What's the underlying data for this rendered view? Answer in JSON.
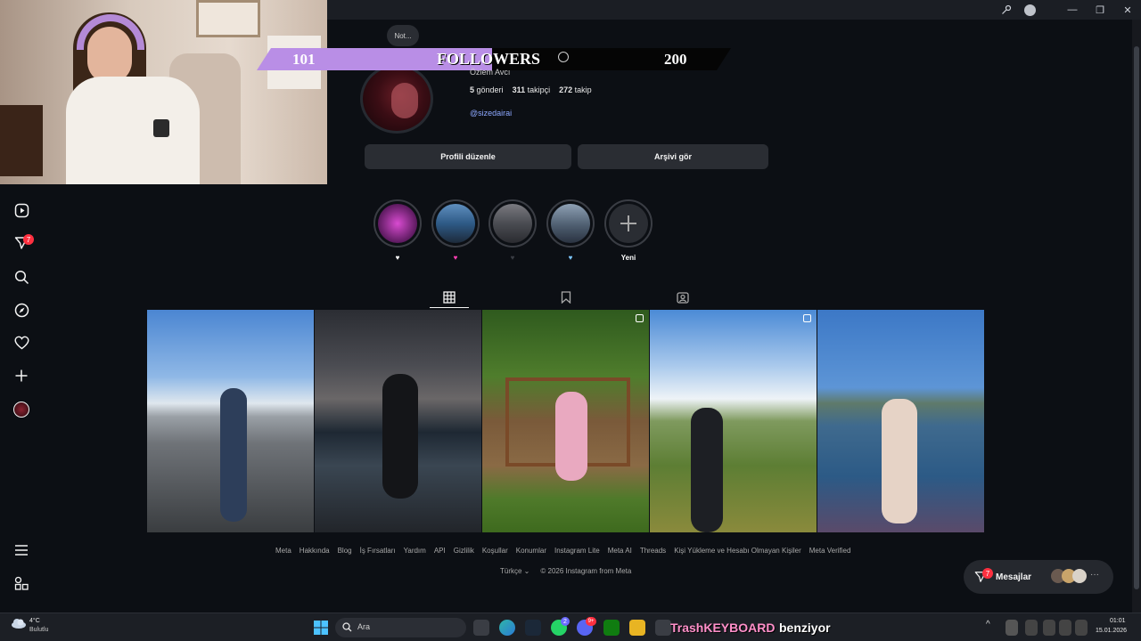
{
  "overlay": {
    "followers_left": "101",
    "followers_label": "FOLLOWERS",
    "followers_right": "200",
    "note_label": "Not..."
  },
  "profile": {
    "full_name": "Özlem Avcı",
    "posts_count": "5",
    "posts_label": "gönderi",
    "followers_count": "311",
    "followers_label": "takipçi",
    "following_count": "272",
    "following_label": "takip",
    "handle": "@sizedairai",
    "edit_button": "Profili düzenle",
    "archive_button": "Arşivi gör"
  },
  "highlights": [
    {
      "label": "♥",
      "color": "#ffffff"
    },
    {
      "label": "♥",
      "color": "#ff3fb4"
    },
    {
      "label": "♥",
      "color": "#3a3d44"
    },
    {
      "label": "♥",
      "color": "#7ec8ff"
    },
    {
      "label": "Yeni",
      "color": "#ffffff"
    }
  ],
  "sidebar": {
    "notification_badge": "7"
  },
  "footer": {
    "links": [
      "Meta",
      "Hakkında",
      "Blog",
      "İş Fırsatları",
      "Yardım",
      "API",
      "Gizlilik",
      "Koşullar",
      "Konumlar",
      "Instagram Lite",
      "Meta AI",
      "Threads",
      "Kişi Yükleme ve Hesabı Olmayan Kişiler",
      "Meta Verified"
    ],
    "language": "Türkçe ⌄",
    "copyright": "© 2026 Instagram from Meta"
  },
  "messages": {
    "label": "Mesajlar",
    "badge": "7"
  },
  "taskbar": {
    "weather_temp": "4°C",
    "weather_desc": "Bulutlu",
    "search_placeholder": "Ara",
    "time": "01:01",
    "date": "15.01.2026",
    "whatsapp_badge": "2",
    "discord_badge": "9+"
  },
  "stream_overlay": {
    "text1": "TrashKEYBOARD",
    "text2": "benziyor"
  },
  "colors": {
    "background": "#0c0f14",
    "banner_purple": "#b98ee6",
    "link_blue": "#8da8ff",
    "badge_red": "#ff3040"
  }
}
